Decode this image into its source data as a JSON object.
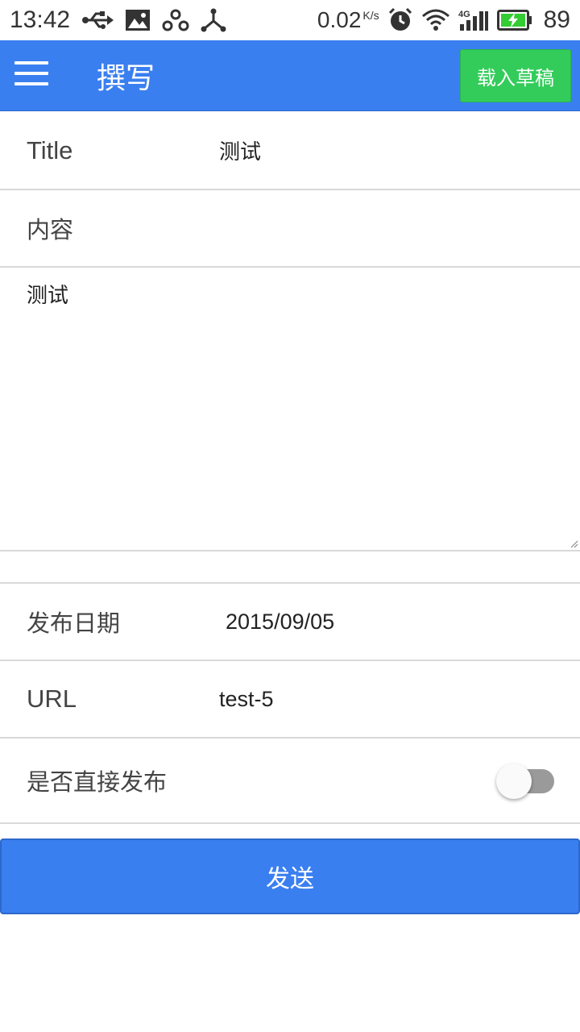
{
  "status_bar": {
    "time": "13:42",
    "left_icons": [
      "usb-icon",
      "image-icon",
      "share-alt-icon",
      "network-icon"
    ],
    "speed": "0.02",
    "speed_unit": "K/s",
    "right_icons": [
      "alarm-icon",
      "wifi-icon",
      "signal-4g-icon",
      "battery-charging-icon"
    ],
    "network_type": "4G",
    "battery_level": "89"
  },
  "appbar": {
    "title": "撰写",
    "load_draft_label": "载入草稿",
    "color": "#3a7ff0",
    "draft_button_color": "#33cc5a"
  },
  "form": {
    "title_label": "Title",
    "title_value": "测试",
    "content_label": "内容",
    "content_value": "测试",
    "date_label": "发布日期",
    "date_value": "2015/09/05",
    "url_label": "URL",
    "url_value": "test-5",
    "publish_label": "是否直接发布",
    "publish_now": false
  },
  "send_button_label": "发送"
}
